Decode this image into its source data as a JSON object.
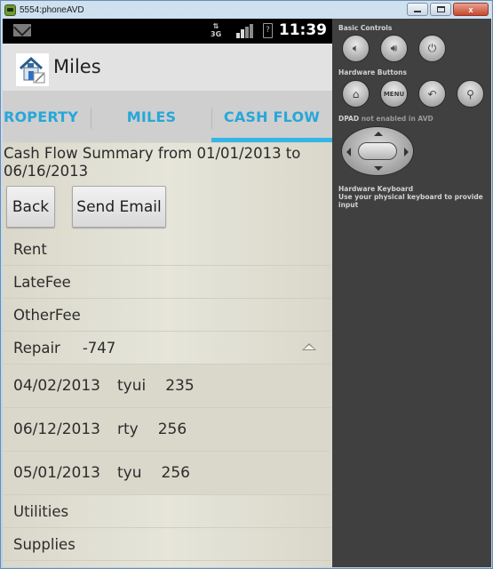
{
  "window": {
    "title": "5554:phoneAVD",
    "minimize_icon": "minimize-icon",
    "maximize_icon": "maximize-icon",
    "close_label": "x"
  },
  "statusbar": {
    "notification_icon": "mail-icon",
    "network_label": "3G",
    "battery_label": "?",
    "time": "11:39"
  },
  "actionbar": {
    "title": "Miles",
    "logo_icon": "house-edit-icon"
  },
  "tabs": [
    {
      "label": "ROPERTY",
      "selected": false
    },
    {
      "label": "MILES",
      "selected": false
    },
    {
      "label": "CASH FLOW",
      "selected": true
    }
  ],
  "summary": {
    "text": "Cash Flow Summary from 01/01/2013 to 06/16/2013"
  },
  "buttons": {
    "back": "Back",
    "send_email": "Send Email"
  },
  "categories": [
    {
      "name": "Rent",
      "amount": ""
    },
    {
      "name": "LateFee",
      "amount": ""
    },
    {
      "name": "OtherFee",
      "amount": ""
    },
    {
      "name": "Repair",
      "amount": "-747",
      "expanded": true,
      "entries": [
        {
          "date": "04/02/2013",
          "desc": "tyui",
          "amount": "235"
        },
        {
          "date": "06/12/2013",
          "desc": "rty",
          "amount": "256"
        },
        {
          "date": "05/01/2013",
          "desc": "tyu",
          "amount": "256"
        }
      ]
    },
    {
      "name": "Utilities",
      "amount": ""
    },
    {
      "name": "Supplies",
      "amount": ""
    }
  ],
  "panel": {
    "basic_controls_label": "Basic Controls",
    "hardware_buttons_label": "Hardware Buttons",
    "menu_label": "MENU",
    "dpad_label": "DPAD",
    "dpad_status": "not enabled in AVD",
    "keyboard_title": "Hardware Keyboard",
    "keyboard_desc": "Use your physical keyboard to provide input"
  }
}
